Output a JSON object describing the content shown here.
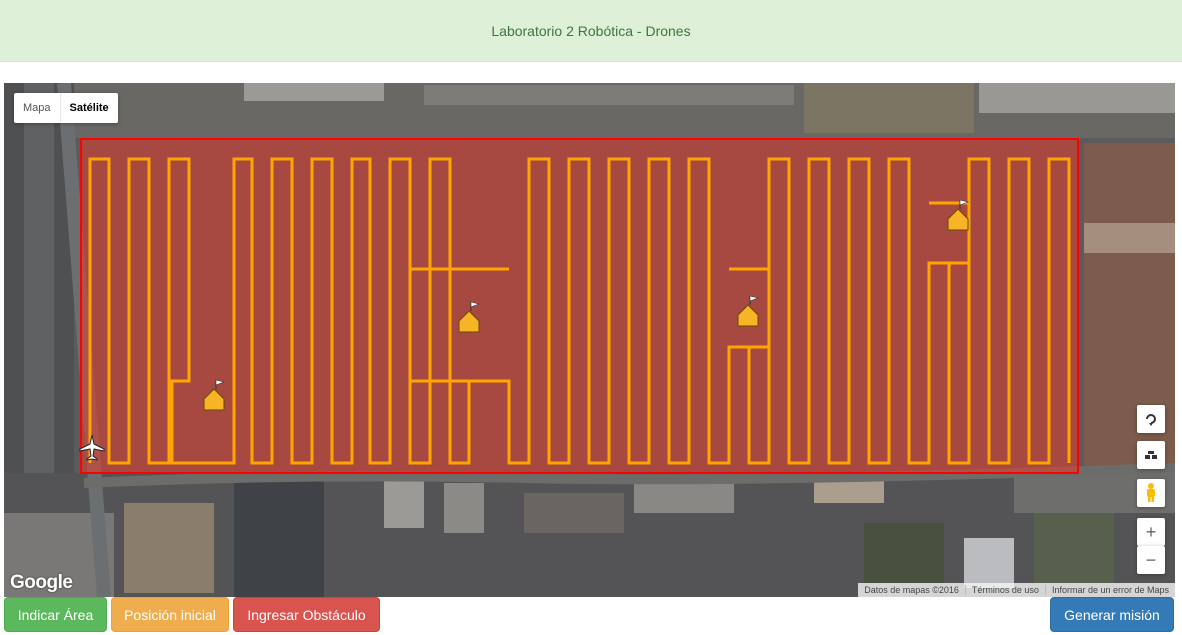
{
  "header": {
    "title": "Laboratorio 2 Robótica - Drones"
  },
  "map": {
    "type_buttons": {
      "map": "Mapa",
      "satellite": "Satélite",
      "selected": "Satélite"
    },
    "logo": "Google",
    "attribution": {
      "data": "Datos de mapas ©2016",
      "terms": "Términos de uso",
      "report": "Informar de un error de Maps"
    },
    "controls": {
      "zoom_in": "+",
      "zoom_out": "−"
    },
    "colors": {
      "area_fill": "#e53c2a",
      "area_border": "#ff0000",
      "path": "#ffa500",
      "marker": "#f6b426"
    },
    "icons": [
      "rotate-icon",
      "tilt-icon",
      "pegman-icon",
      "drone-icon",
      "obstacle-flag-icon"
    ]
  },
  "actions": {
    "indicate_area": "Indicar Área",
    "start_position": "Posición inicial",
    "add_obstacle": "Ingresar Obstáculo",
    "generate_mission": "Generar misión"
  }
}
